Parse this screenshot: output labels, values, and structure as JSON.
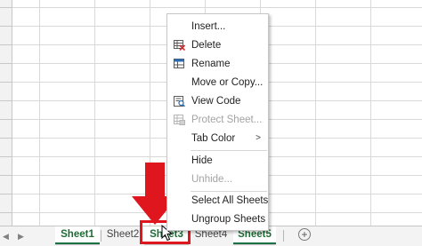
{
  "context_menu": {
    "items": [
      {
        "label": "Insert...",
        "enabled": true,
        "icon": ""
      },
      {
        "label": "Delete",
        "enabled": true,
        "icon": "delete-sheet-icon"
      },
      {
        "label": "Rename",
        "enabled": true,
        "icon": "rename-sheet-icon"
      },
      {
        "label": "Move or Copy...",
        "enabled": true,
        "icon": ""
      },
      {
        "label": "View Code",
        "enabled": true,
        "icon": "view-code-icon"
      },
      {
        "label": "Protect Sheet...",
        "enabled": false,
        "icon": "protect-sheet-icon"
      },
      {
        "label": "Tab Color",
        "enabled": true,
        "icon": "",
        "submenu_arrow": ">"
      },
      {
        "label": "Hide",
        "enabled": true,
        "icon": ""
      },
      {
        "label": "Unhide...",
        "enabled": false,
        "icon": ""
      },
      {
        "label": "Select All Sheets",
        "enabled": true,
        "icon": ""
      },
      {
        "label": "Ungroup Sheets",
        "enabled": true,
        "icon": ""
      }
    ]
  },
  "sheet_tabs": [
    {
      "label": "Sheet1",
      "active": true
    },
    {
      "label": "Sheet2",
      "active": false
    },
    {
      "label": "Sheet3",
      "active": true,
      "highlighted": true
    },
    {
      "label": "Sheet4",
      "active": false
    },
    {
      "label": "Sheet5",
      "active": true
    }
  ],
  "add_sheet": {
    "symbol": "+"
  },
  "nav": {
    "prev": "◀",
    "next": "▶"
  },
  "colors": {
    "accent_green": "#1e7145",
    "highlight_red": "#e0161e",
    "menu_disabled": "#a3a3a3"
  }
}
